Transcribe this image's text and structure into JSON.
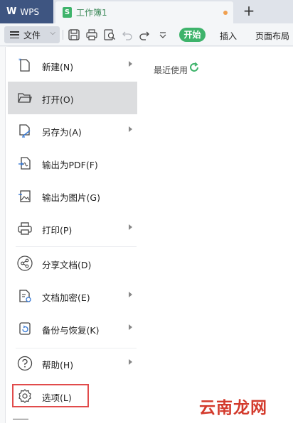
{
  "tabbar": {
    "app_name": "WPS",
    "doc_icon": "S",
    "doc_title": "工作簿1",
    "new_tab_label": "+"
  },
  "toolbar": {
    "file_label": "文件",
    "tabs": [
      "开始",
      "插入",
      "页面布局"
    ],
    "icons": [
      "save-icon",
      "print-icon",
      "print-preview-icon",
      "undo-icon",
      "redo-icon",
      "dropdown-icon"
    ]
  },
  "menu": {
    "items": [
      {
        "label": "新建(N)",
        "icon": "new-file-icon",
        "submenu": true
      },
      {
        "label": "打开(O)",
        "icon": "open-folder-icon",
        "submenu": false,
        "active": true
      },
      {
        "label": "另存为(A)",
        "icon": "save-as-icon",
        "submenu": true
      },
      {
        "label": "输出为PDF(F)",
        "icon": "export-pdf-icon",
        "submenu": false
      },
      {
        "label": "输出为图片(G)",
        "icon": "export-image-icon",
        "submenu": false
      },
      {
        "label": "打印(P)",
        "icon": "print-icon",
        "submenu": true
      },
      {
        "label": "分享文档(D)",
        "icon": "share-icon",
        "submenu": false
      },
      {
        "label": "文档加密(E)",
        "icon": "encrypt-icon",
        "submenu": true
      },
      {
        "label": "备份与恢复(K)",
        "icon": "backup-icon",
        "submenu": true
      },
      {
        "label": "帮助(H)",
        "icon": "help-icon",
        "submenu": true
      },
      {
        "label": "选项(L)",
        "icon": "gear-icon",
        "submenu": false
      }
    ]
  },
  "recent": {
    "title": "最近使用"
  },
  "watermark": "云南龙网",
  "colors": {
    "accent_green": "#3eb36b",
    "wps_tab": "#3e5581",
    "highlight_red": "#e14b4b"
  }
}
